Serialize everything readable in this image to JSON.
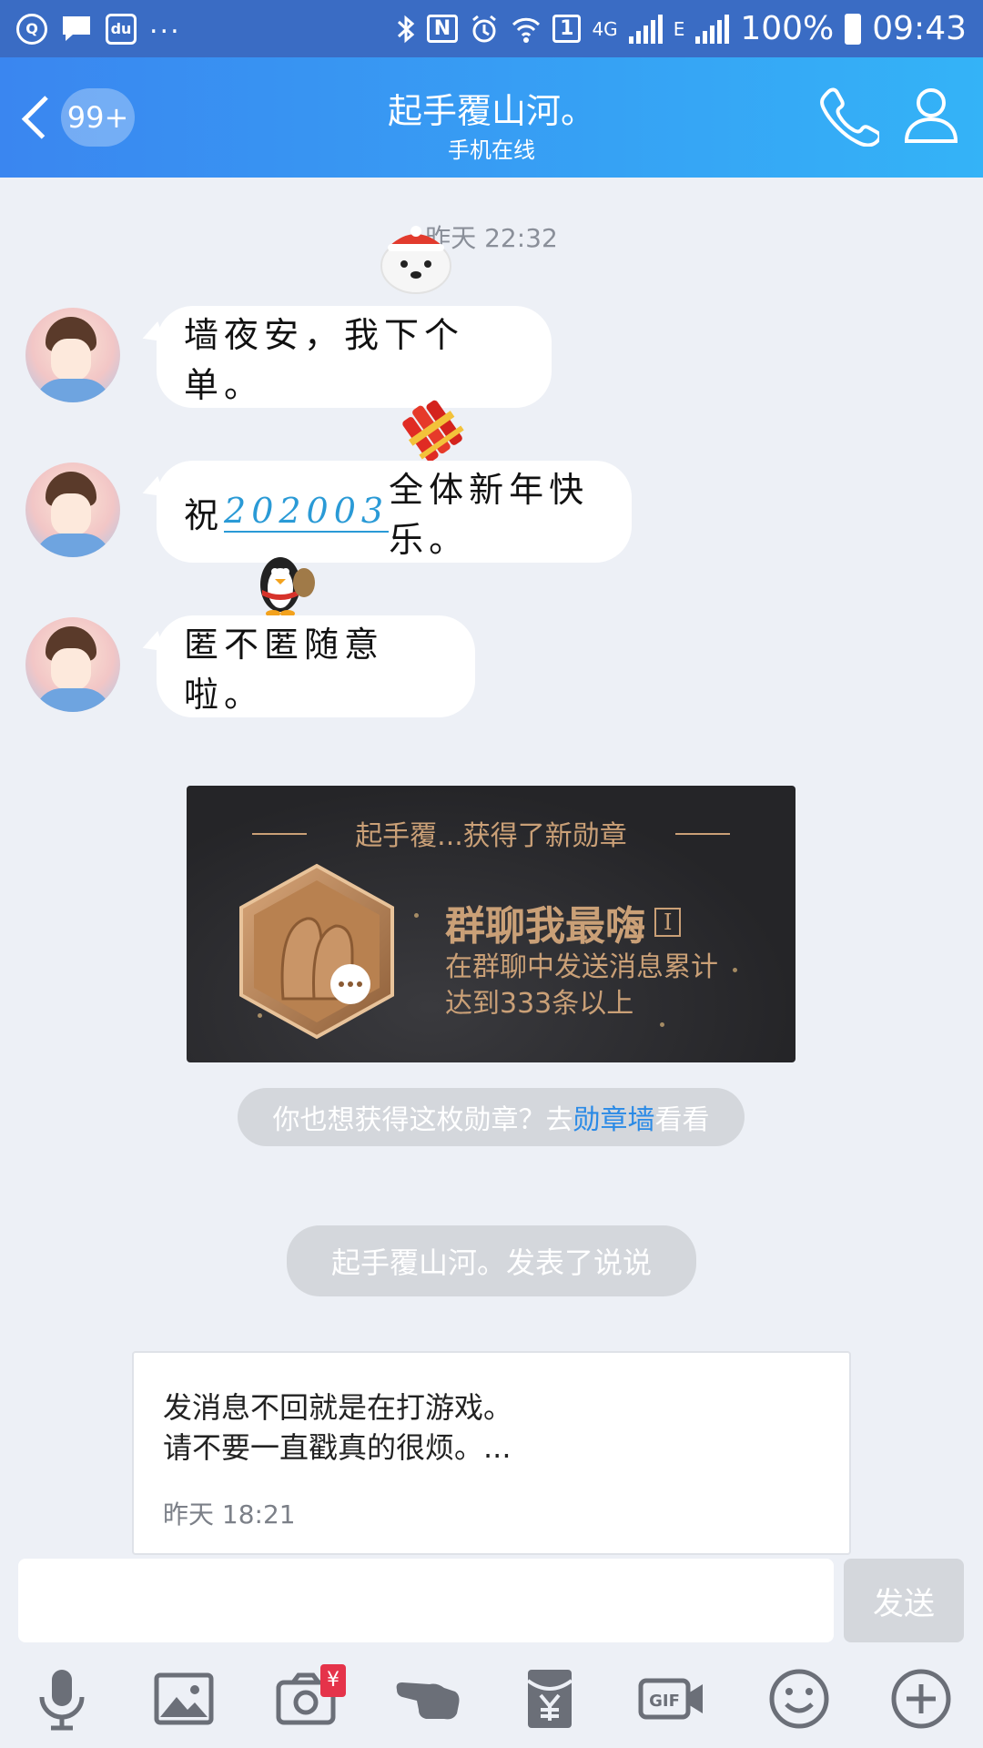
{
  "status_bar": {
    "battery": "100%",
    "time": "09:43",
    "network": "4G",
    "network2": "E",
    "sim": "1",
    "nfc": "N",
    "overflow": "..."
  },
  "header": {
    "back_badge": "99+",
    "title": "起手覆山河。",
    "subtitle": "手机在线"
  },
  "chat": {
    "timestamp": "昨天 22:32",
    "messages": [
      {
        "text": "墙夜安，我下个单。"
      },
      {
        "prefix": "祝",
        "link": "202003",
        "suffix": "全体新年快乐。"
      },
      {
        "text": "匿不匿随意啦。"
      }
    ]
  },
  "medal": {
    "header": "起手覆...获得了新勋章",
    "name": "群聊我最嗨",
    "level": "I",
    "description_line1": "在群聊中发送消息累计",
    "description_line2": "达到333条以上"
  },
  "medal_prompt": {
    "before": "你也想获得这枚勋章？去",
    "link": "勋章墙",
    "after": "看看"
  },
  "post_notice": "起手覆山河。发表了说说",
  "post_card": {
    "line1": "发消息不回就是在打游戏。",
    "line2": "请不要一直戳真的很烦。...",
    "time": "昨天 18:21"
  },
  "input": {
    "placeholder": "",
    "send_label": "发送"
  },
  "toolbar": {
    "items": [
      "microphone-icon",
      "image-icon",
      "camera-icon",
      "poke-icon",
      "red-packet-icon",
      "gif-icon",
      "emoji-icon",
      "plus-icon"
    ],
    "camera_badge": "¥"
  },
  "colors": {
    "header_start": "#3a86f0",
    "header_end": "#34b3f7",
    "link": "#2a9ad6",
    "medal_gold": "#caa077"
  }
}
